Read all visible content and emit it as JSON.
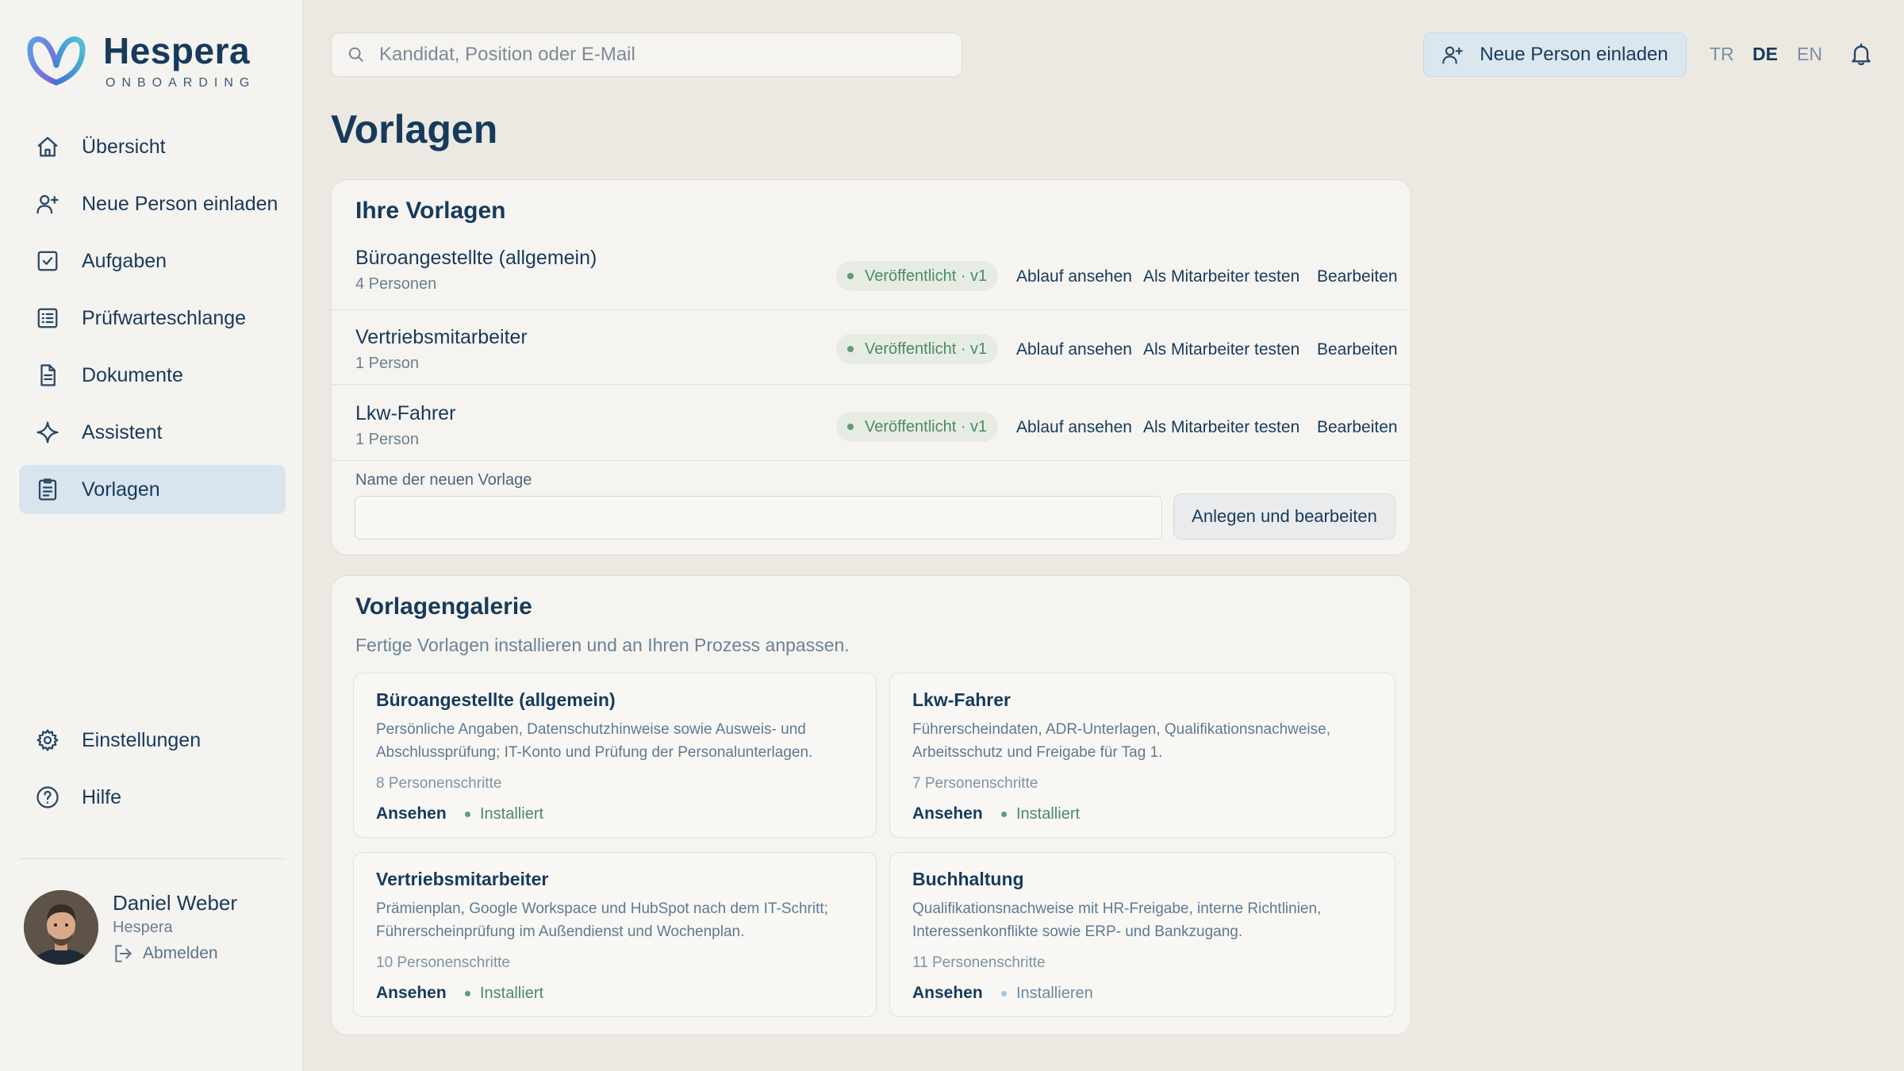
{
  "brand": {
    "name": "Hespera",
    "subtitle": "ONBOARDING"
  },
  "nav": {
    "items": [
      {
        "label": "Übersicht",
        "icon": "home-icon"
      },
      {
        "label": "Neue Person einladen",
        "icon": "user-plus-icon"
      },
      {
        "label": "Aufgaben",
        "icon": "check-square-icon"
      },
      {
        "label": "Prüfwarteschlange",
        "icon": "list-icon"
      },
      {
        "label": "Dokumente",
        "icon": "document-icon"
      },
      {
        "label": "Assistent",
        "icon": "sparkle-icon"
      },
      {
        "label": "Vorlagen",
        "icon": "clipboard-icon",
        "active": true
      }
    ],
    "bottom": [
      {
        "label": "Einstellungen",
        "icon": "gear-icon"
      },
      {
        "label": "Hilfe",
        "icon": "help-icon"
      }
    ]
  },
  "user": {
    "name": "Daniel Weber",
    "org": "Hespera",
    "logout": "Abmelden"
  },
  "header": {
    "search_placeholder": "Kandidat, Position oder E-Mail",
    "invite_label": "Neue Person einladen",
    "languages": {
      "tr": "TR",
      "de": "DE",
      "en": "EN"
    },
    "active_language": "DE"
  },
  "page": {
    "title": "Vorlagen"
  },
  "templates": {
    "title": "Ihre Vorlagen",
    "rows": [
      {
        "name": "Büroangestellte (allgemein)",
        "count": "4 Personen",
        "status": "Veröffentlicht · v1"
      },
      {
        "name": "Vertriebsmitarbeiter",
        "count": "1 Person",
        "status": "Veröffentlicht · v1"
      },
      {
        "name": "Lkw-Fahrer",
        "count": "1 Person",
        "status": "Veröffentlicht · v1"
      }
    ],
    "actions": {
      "view": "Ablauf ansehen",
      "test": "Als Mitarbeiter testen",
      "edit": "Bearbeiten"
    },
    "new_label": "Name der neuen Vorlage",
    "new_value": "",
    "create_label": "Anlegen und bearbeiten"
  },
  "gallery": {
    "title": "Vorlagengalerie",
    "subtitle": "Fertige Vorlagen installieren und an Ihren Prozess anpassen.",
    "view_label": "Ansehen",
    "cards": [
      {
        "title": "Büroangestellte (allgemein)",
        "desc": "Persönliche Angaben, Datenschutzhinweise sowie Ausweis- und Abschlussprüfung; IT-Konto und Prüfung der Personalunterlagen.",
        "steps": "8 Personenschritte",
        "status": "Installiert"
      },
      {
        "title": "Lkw-Fahrer",
        "desc": "Führerscheindaten, ADR-Unterlagen, Qualifikationsnachweise, Arbeitsschutz und Freigabe für Tag 1.",
        "steps": "7 Personenschritte",
        "status": "Installiert"
      },
      {
        "title": "Vertriebsmitarbeiter",
        "desc": "Prämienplan, Google Workspace und HubSpot nach dem IT-Schritt; Führerscheinprüfung im Außendienst und Wochenplan.",
        "steps": "10 Personenschritte",
        "status": "Installiert"
      },
      {
        "title": "Buchhaltung",
        "desc": "Qualifikationsnachweise mit HR-Freigabe, interne Richtlinien, Interessenkonflikte sowie ERP- und Bankzugang.",
        "steps": "11 Personenschritte",
        "status": "Installieren"
      }
    ]
  },
  "colors": {
    "primary": "#173a5c",
    "accent": "#dbe7ef",
    "success": "#4d8a66",
    "background": "#ece9e3"
  }
}
